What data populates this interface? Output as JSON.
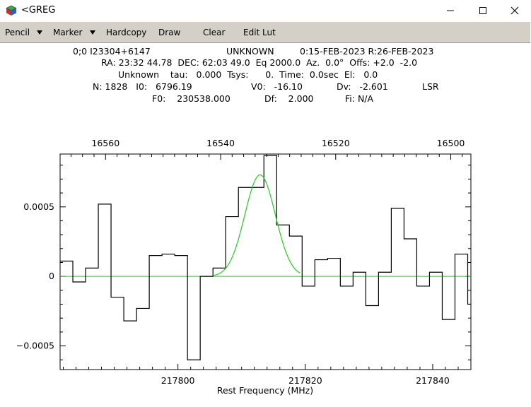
{
  "window": {
    "title": "<GREG",
    "app_icon": "greg-cube-icon",
    "controls": [
      "minimize-icon",
      "maximize-icon",
      "close-icon"
    ]
  },
  "toolbar": {
    "items": [
      {
        "label": "Pencil",
        "has_dropdown": true
      },
      {
        "label": "Marker",
        "has_dropdown": true
      },
      {
        "label": "Hardcopy",
        "has_dropdown": false
      },
      {
        "label": "Draw",
        "has_dropdown": false
      },
      {
        "label": "Clear",
        "has_dropdown": false
      },
      {
        "label": "Edit Lut",
        "has_dropdown": false
      }
    ]
  },
  "header": {
    "line1": {
      "scan": "0;0 I23304+6147",
      "telescope": "UNKNOWN",
      "obs_date": "0:15-FEB-2023 R:26-FEB-2023"
    },
    "line2": "RA: 23:32 44.78  DEC: 62:03 49.0  Eq 2000.0  Az.  0.0°  Offs: +2.0  -2.0",
    "line3": "Unknown    tau:   0.000  Tsys:      0.  Time:  0.0sec  El:   0.0",
    "line4": {
      "n": "N: 1828   I0:   6796.19",
      "v0": "V0:   -16.10",
      "dv": "Dv:   -2.601",
      "frame": "LSR"
    },
    "line5": {
      "f0": "F0:    230538.000",
      "df": "Df:    2.000",
      "fi": "Fi: N/A"
    }
  },
  "colors": {
    "spectrum": "#000000",
    "fit": "#22cc22",
    "frame": "#000000"
  },
  "chart_data": {
    "type": "line",
    "xlabel": "Rest Frequency (MHz)",
    "x_range": [
      217781.5,
      217846.0
    ],
    "top_axis_range": [
      16567.9,
      16496.5
    ],
    "ylim": [
      -0.00067,
      0.00088
    ],
    "bottom_ticks": [
      217800,
      217820,
      217840
    ],
    "bottom_tick_labels": [
      "217800",
      "217820",
      "217840"
    ],
    "top_ticks": [
      16560,
      16540,
      16520,
      16500
    ],
    "top_tick_labels": [
      "16560",
      "16540",
      "16520",
      "16500"
    ],
    "y_ticks": [
      -0.0005,
      0,
      0.0005
    ],
    "y_tick_labels": [
      "−0.0005",
      "0",
      "0.0005"
    ],
    "series": [
      {
        "style": "histogram",
        "channel_width_mhz": 2.0,
        "x_start": 217781.5,
        "values": [
          0.00011,
          -4e-05,
          6e-05,
          0.00052,
          -0.00015,
          -0.00032,
          -0.00023,
          0.00015,
          0.00016,
          0.00015,
          -0.0006,
          0.0,
          6e-05,
          0.00043,
          0.00064,
          0.00064,
          0.00087,
          0.00037,
          0.00029,
          -7e-05,
          0.00012,
          0.00013,
          -7e-05,
          3e-05,
          -0.00021,
          3e-05,
          0.00049,
          0.00027,
          -7e-05,
          3e-05,
          -0.00031,
          0.00016,
          -0.0002
        ]
      },
      {
        "style": "fit",
        "baseline": 0.0,
        "amplitude": 0.00073,
        "center_mhz": 217812.9,
        "sigma_mhz": 2.4,
        "support_mhz": [
          217805.5,
          217819.2
        ]
      }
    ]
  }
}
